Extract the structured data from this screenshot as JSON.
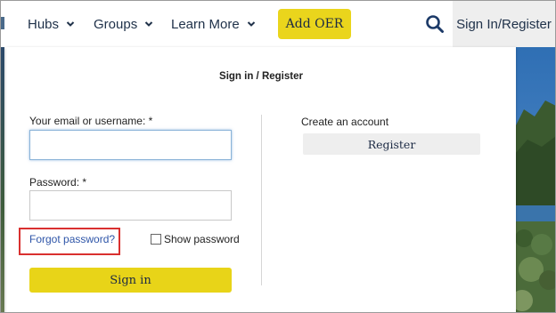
{
  "nav": {
    "items": [
      {
        "label": "Hubs"
      },
      {
        "label": "Groups"
      },
      {
        "label": "Learn More"
      }
    ],
    "add_oer_label": "Add OER",
    "signin_tab_label": "Sign In/Register",
    "search_icon": "search-icon",
    "accent_color": "#ead51c",
    "text_color": "#20324a"
  },
  "panel": {
    "title": "Sign in / Register",
    "email_label": "Your email or username: *",
    "email_value": "",
    "password_label": "Password: *",
    "password_value": "",
    "forgot_label": "Forgot password?",
    "show_password_label": "Show password",
    "show_password_checked": false,
    "signin_label": "Sign in",
    "create_account_label": "Create an account",
    "register_label": "Register",
    "highlight_color": "#d9302f"
  }
}
